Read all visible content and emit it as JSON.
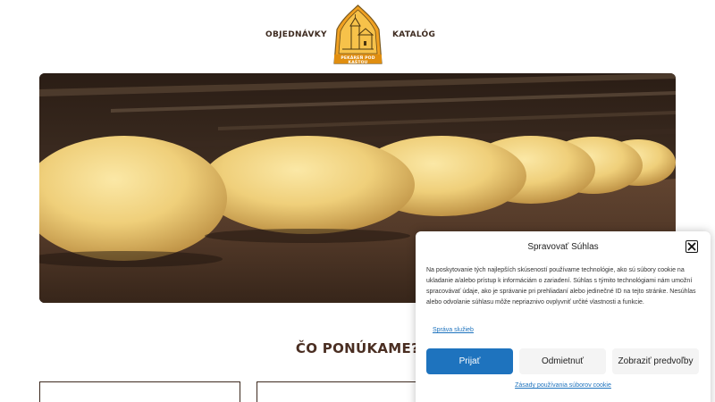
{
  "nav": {
    "left_label": "OBJEDNÁVKY",
    "right_label": "KATALÓG",
    "logo_text": "PEKÁREŇ POD KAŠTOU",
    "logo_icon": "bakery-logo-icon"
  },
  "hero": {
    "image": "bread-loaves-in-oven"
  },
  "section": {
    "title": "ČO PONÚKAME?"
  },
  "cookie": {
    "title": "Spravovať Súhlas",
    "close_icon": "close-icon",
    "text": "Na poskytovanie tých najlepších skúseností používame technológie, ako sú súbory cookie na ukladanie a/alebo prístup k informáciám o zariadení. Súhlas s týmito technológiami nám umožní spracovávať údaje, ako je správanie pri prehliadaní alebo jedinečné ID na tejto stránke. Nesúhlas alebo odvolanie súhlasu môže nepriaznivo ovplyvniť určité vlastnosti a funkcie.",
    "services_link": "Správa služieb",
    "accept_label": "Prijať",
    "deny_label": "Odmietnuť",
    "prefs_label": "Zobraziť predvoľby",
    "policy_link": "Zásady používania súborov cookie"
  },
  "colors": {
    "brand_brown": "#4a2e22",
    "logo_orange": "#f0a020",
    "accent_blue": "#1e73be"
  }
}
